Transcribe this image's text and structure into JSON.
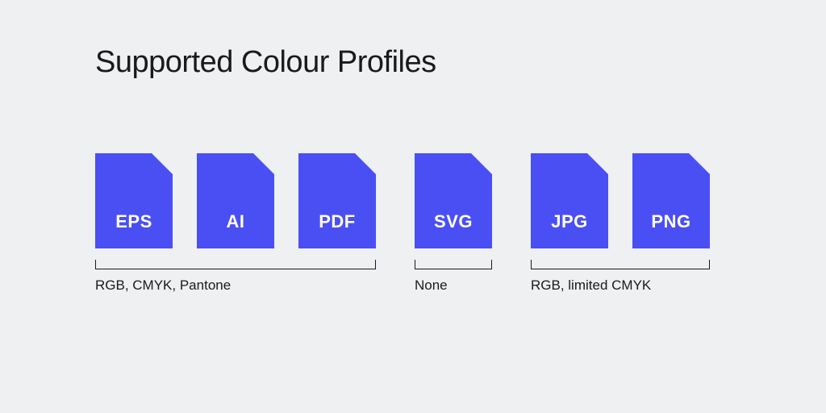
{
  "title": "Supported Colour Profiles",
  "colors": {
    "icon_fill": "#4a4ff4",
    "background": "#eef0f2",
    "text": "#1a1a1a",
    "icon_text": "#ffffff"
  },
  "groups": [
    {
      "files": [
        {
          "label": "EPS",
          "name": "file-icon-eps"
        },
        {
          "label": "AI",
          "name": "file-icon-ai"
        },
        {
          "label": "PDF",
          "name": "file-icon-pdf"
        }
      ],
      "caption": "RGB, CMYK, Pantone"
    },
    {
      "files": [
        {
          "label": "SVG",
          "name": "file-icon-svg"
        }
      ],
      "caption": "None"
    },
    {
      "files": [
        {
          "label": "JPG",
          "name": "file-icon-jpg"
        },
        {
          "label": "PNG",
          "name": "file-icon-png"
        }
      ],
      "caption": "RGB, limited CMYK"
    }
  ]
}
